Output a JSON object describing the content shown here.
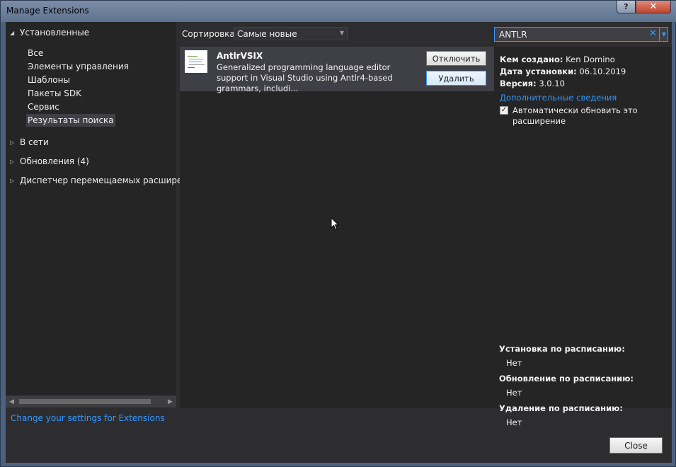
{
  "window": {
    "title": "Manage Extensions",
    "help_label": "?",
    "close_label": "✕"
  },
  "sidebar": {
    "installed_label": "Установленные",
    "items": [
      {
        "label": "Все"
      },
      {
        "label": "Элементы управления"
      },
      {
        "label": "Шаблоны"
      },
      {
        "label": "Пакеты SDK"
      },
      {
        "label": "Сервис"
      },
      {
        "label": "Результаты поиска",
        "selected": true
      }
    ],
    "online_label": "В сети",
    "updates_label": "Обновления (4)",
    "roaming_label": "Диспетчер перемещаемых расширени"
  },
  "settings_link": "Change your settings for Extensions",
  "sort": {
    "label": "Сортировка:",
    "value": "Самые новые"
  },
  "search": {
    "value": "ANTLR"
  },
  "extension": {
    "name": "AntlrVSIX",
    "description": "Generalized programming language editor support in Visual Studio using Antlr4-based grammars, includi...",
    "disable_label": "Отключить",
    "remove_label": "Удалить"
  },
  "details": {
    "created_by_label": "Кем создано:",
    "created_by": "Ken Domino",
    "install_date_label": "Дата установки:",
    "install_date": "06.10.2019",
    "version_label": "Версия:",
    "version": "3.0.10",
    "more_info": "Дополнительные сведения",
    "auto_update_label": "Автоматически обновить это расширение",
    "auto_update_checked": true,
    "scheduled_install_label": "Установка по расписанию:",
    "scheduled_install": "Нет",
    "scheduled_update_label": "Обновление по расписанию:",
    "scheduled_update": "Нет",
    "scheduled_remove_label": "Удаление по расписанию:",
    "scheduled_remove": "Нет"
  },
  "close_button": "Close",
  "colors": {
    "accent": "#3399ff",
    "background": "#2d2d30",
    "panel": "#252526",
    "selected": "#3f3f46"
  }
}
